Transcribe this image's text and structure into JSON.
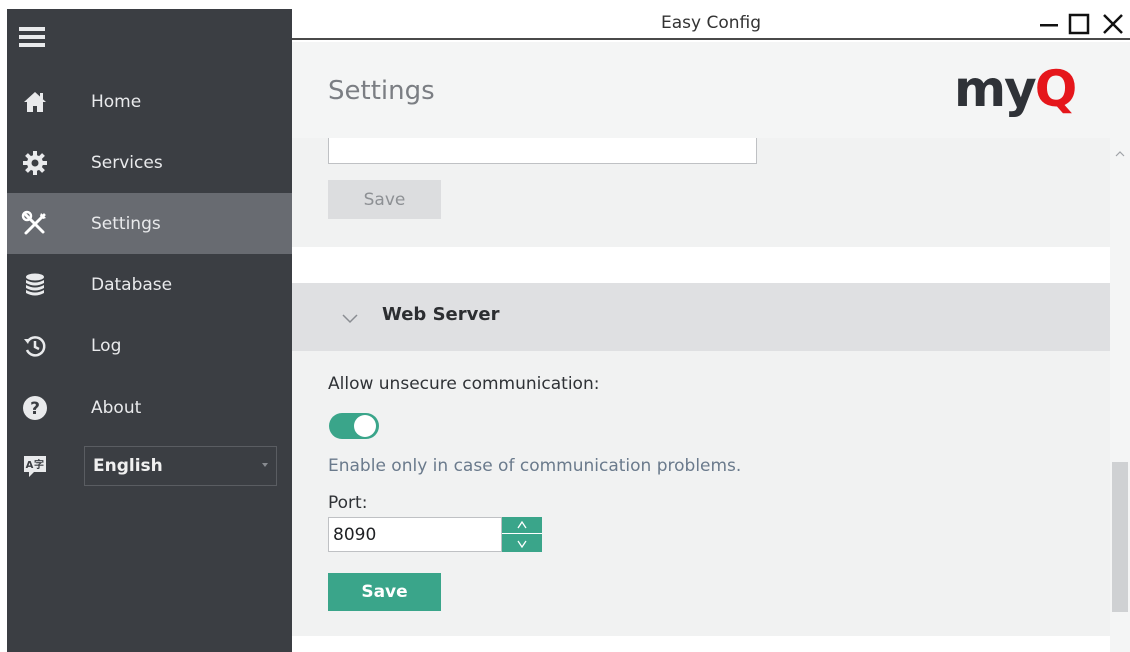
{
  "window": {
    "title": "Easy Config"
  },
  "sidebar": {
    "items": [
      {
        "label": "Home",
        "icon": "home-icon"
      },
      {
        "label": "Services",
        "icon": "gear-icon"
      },
      {
        "label": "Settings",
        "icon": "tools-icon",
        "active": true
      },
      {
        "label": "Database",
        "icon": "database-icon"
      },
      {
        "label": "Log",
        "icon": "history-icon"
      },
      {
        "label": "About",
        "icon": "help-icon"
      }
    ],
    "language": {
      "icon": "language-icon",
      "selected": "English"
    }
  },
  "header": {
    "title": "Settings",
    "logo": "myQ"
  },
  "content": {
    "top_block": {
      "save_label": "Save"
    },
    "web_server": {
      "title": "Web Server",
      "unsecure_label": "Allow unsecure communication:",
      "unsecure_enabled": true,
      "hint": "Enable only in case of communication problems.",
      "port_label": "Port:",
      "port_value": "8090",
      "save_label": "Save"
    }
  },
  "colors": {
    "accent": "#3aa58a",
    "sidebar_bg": "#3b3e43",
    "sidebar_active": "#686b71",
    "logo_red": "#e5161b"
  }
}
